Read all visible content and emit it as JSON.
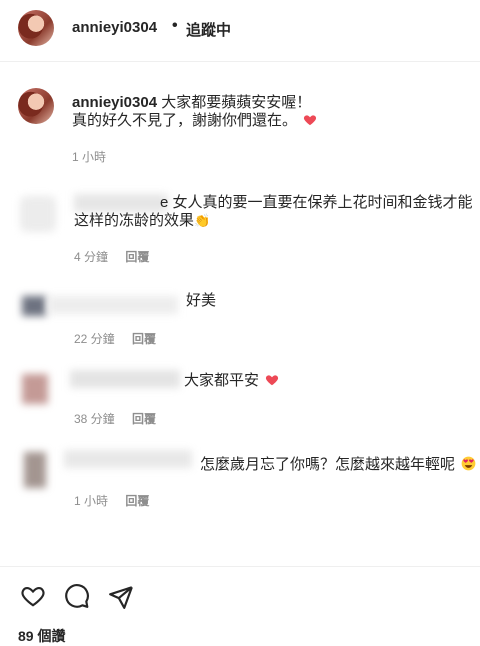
{
  "header": {
    "username": "annieyi0304",
    "dot": "•",
    "follow": "追蹤中"
  },
  "caption": {
    "username": "annieyi0304",
    "text_line1": "大家都要蘋蘋安安喔！",
    "text_line2": "真的好久不見了，謝謝你們還在。",
    "time": "1 小時"
  },
  "comments": [
    {
      "line1": "女人真的要一直要在保养上花时间和金钱才能",
      "line2": "这样的冻龄的效果",
      "time": "4 分鐘",
      "reply": "回覆",
      "prefix": "e"
    },
    {
      "line1": "好美",
      "time": "22 分鐘",
      "reply": "回覆"
    },
    {
      "line1": "大家都平安",
      "time": "38 分鐘",
      "reply": "回覆"
    },
    {
      "line1": "怎麼歲月忘了你嗎？怎麼越來越年輕呢",
      "time": "1 小時",
      "reply": "回覆"
    }
  ],
  "actions": {
    "like_icon": "heart-outline-icon",
    "comment_icon": "comment-bubble-icon",
    "share_icon": "paper-plane-icon"
  },
  "likes": "89 個讚",
  "colors": {
    "heart_red": "#ed4956",
    "meta_gray": "#8e8e8e"
  }
}
